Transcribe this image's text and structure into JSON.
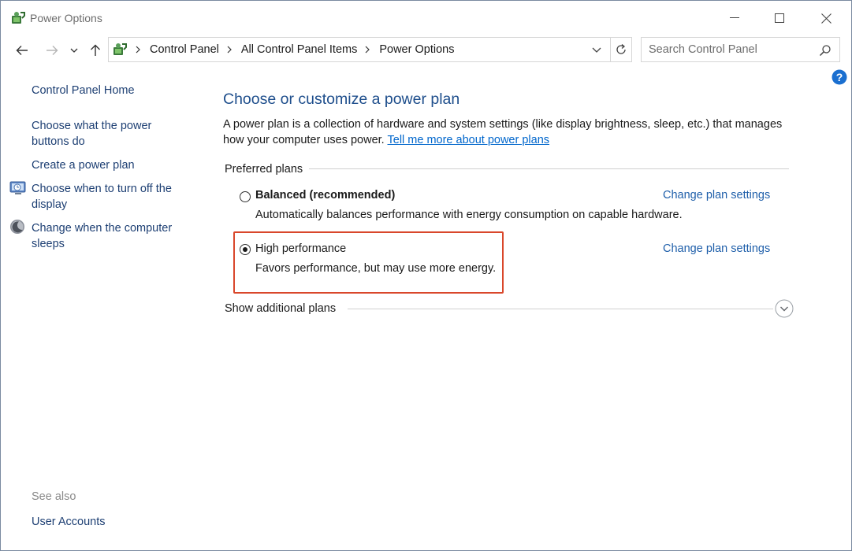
{
  "window": {
    "title": "Power Options"
  },
  "address": {
    "crumbs": [
      "Control Panel",
      "All Control Panel Items",
      "Power Options"
    ]
  },
  "search": {
    "placeholder": "Search Control Panel",
    "value": ""
  },
  "sidebar": {
    "items": [
      {
        "label": "Control Panel Home",
        "icon": null
      },
      {
        "label": "Choose what the power buttons do",
        "icon": null
      },
      {
        "label": "Create a power plan",
        "icon": null
      },
      {
        "label": "Choose when to turn off the display",
        "icon": "monitor-icon"
      },
      {
        "label": "Change when the computer sleeps",
        "icon": "moon-icon"
      }
    ],
    "see_also_label": "See also",
    "see_also_items": [
      "User Accounts"
    ]
  },
  "main": {
    "title": "Choose or customize a power plan",
    "intro_text": "A power plan is a collection of hardware and system settings (like display brightness, sleep, etc.) that manages how your computer uses power.",
    "intro_link": "Tell me more about power plans",
    "preferred_label": "Preferred plans",
    "plans": [
      {
        "name": "Balanced (recommended)",
        "description": "Automatically balances performance with energy consumption on capable hardware.",
        "selected": false,
        "link": "Change plan settings"
      },
      {
        "name": "High performance",
        "description": "Favors performance, but may use more energy.",
        "selected": true,
        "link": "Change plan settings"
      }
    ],
    "show_additional": "Show additional plans"
  },
  "colors": {
    "link": "#1f5faa",
    "title": "#1e4e8c",
    "highlight": "#d9472b"
  }
}
